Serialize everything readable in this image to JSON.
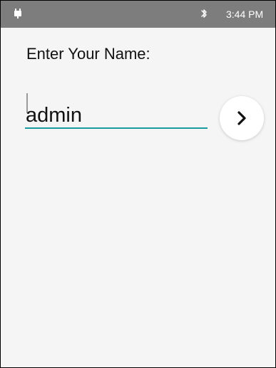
{
  "status_bar": {
    "time": "3:44 PM",
    "left_icon": "android-icon",
    "bluetooth_icon": "bluetooth-icon",
    "background_color": "#7d7d7d"
  },
  "form": {
    "label": "Enter Your Name:",
    "name_value": "admin",
    "underline_color": "#159ba0"
  },
  "next_button": {
    "icon": "chevron-right-icon"
  }
}
